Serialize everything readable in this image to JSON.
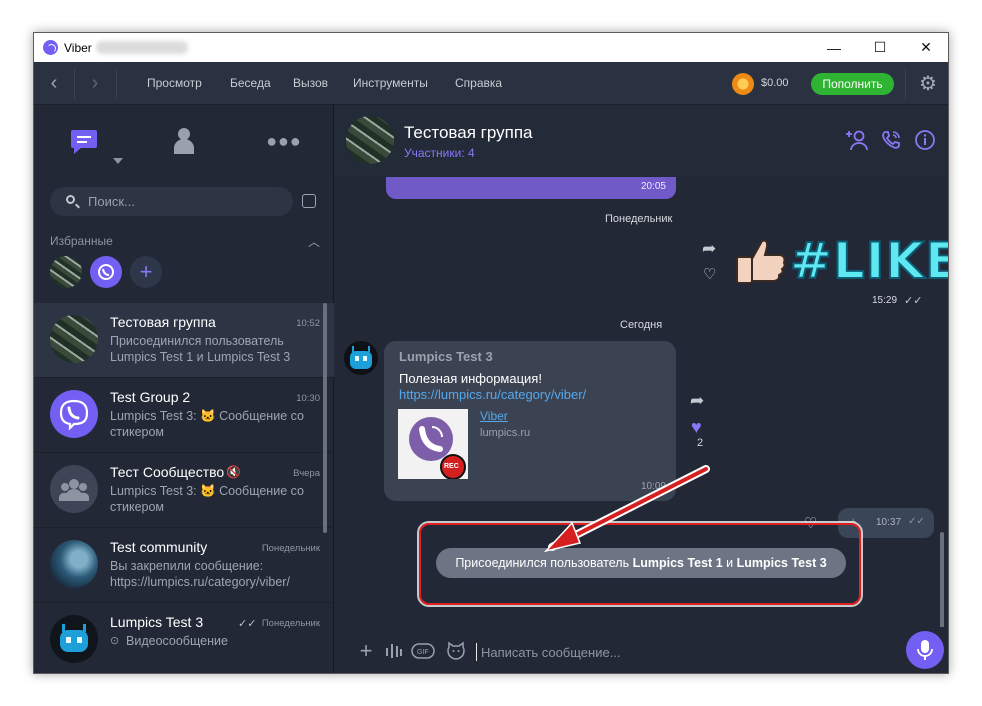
{
  "window": {
    "title": "Viber",
    "controls": {
      "minimize": "—",
      "maximize": "☐",
      "close": "✕"
    }
  },
  "menubar": {
    "back": "‹",
    "forward": "›",
    "items": [
      "Просмотр",
      "Беседа",
      "Вызов",
      "Инструменты",
      "Справка"
    ],
    "balance": "$0.00",
    "topup": "Пополнить"
  },
  "sidebar": {
    "search_placeholder": "Поиск...",
    "favorites_label": "Избранные",
    "chats": [
      {
        "name": "Тестовая группа",
        "time": "10:52",
        "preview": "Присоединился пользователь Lumpics Test 1 и Lumpics Test 3"
      },
      {
        "name": "Test Group 2",
        "time": "10:30",
        "preview": "Lumpics Test 3: 🐱 Сообщение со стикером"
      },
      {
        "name": "Тест Сообщество",
        "time": "Вчера",
        "preview": "Lumpics Test 3: 🐱 Сообщение со стикером"
      },
      {
        "name": "Test community",
        "time": "Понедельник",
        "preview": "Вы закрепили сообщение: https://lumpics.ru/category/viber/"
      },
      {
        "name": "Lumpics Test 3",
        "time": "Понедельник",
        "preview": "Видеосообщение"
      }
    ]
  },
  "chat": {
    "title": "Тестовая группа",
    "members": "Участники: 4",
    "prev_time": "20:05",
    "day_monday": "Понедельник",
    "sticker_text": "#LIKE",
    "sticker_time": "15:29",
    "day_today": "Сегодня",
    "message": {
      "sender": "Lumpics Test 3",
      "text": "Полезная информация! ",
      "link": "https://lumpics.ru/category/viber/",
      "preview_title": "Viber",
      "preview_host": "lumpics.ru",
      "thumb_badge": "REC",
      "time": "10:09",
      "likes": "2"
    },
    "outgoing_time": "10:37",
    "notice": {
      "prefix": "Присоединился пользователь ",
      "user1": "Lumpics Test 1",
      "conj": " и ",
      "user2": "Lumpics Test 3"
    },
    "input_placeholder": "Написать сообщение..."
  },
  "colors": {
    "accent": "#7360f2",
    "topup_green": "#2fb333",
    "highlight_red": "#e02020",
    "background": "#222836"
  }
}
